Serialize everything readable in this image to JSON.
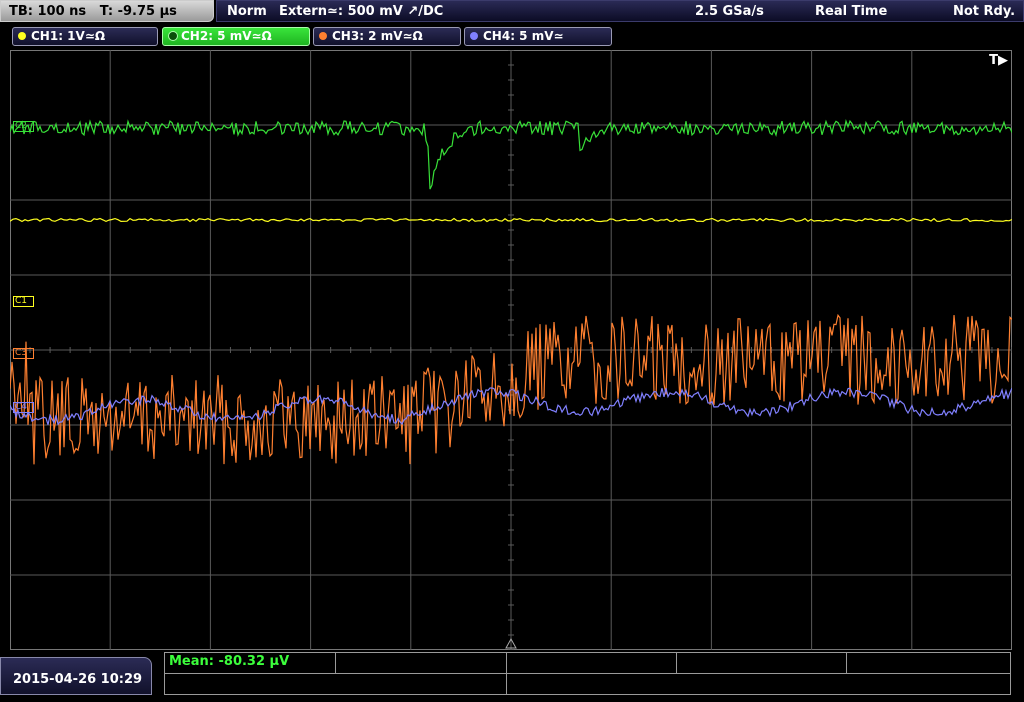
{
  "topbar": {
    "timebase": "TB: 100 ns",
    "trigger_time": "T: -9.75 µs",
    "mode": "Norm",
    "trigger_source": "Extern≃: 500 mV ↗/DC",
    "sample_rate": "2.5 GSa/s",
    "acq_mode": "Real Time",
    "status": "Not Rdy."
  },
  "channels": [
    {
      "label": "CH1: 1V≃Ω",
      "color": "#ffff20",
      "active": false
    },
    {
      "label": "CH2: 5 mV≃Ω",
      "color": "#38e038",
      "active": true
    },
    {
      "label": "CH3: 2 mV≃Ω",
      "color": "#ff8030",
      "active": false
    },
    {
      "label": "CH4: 5 mV≃",
      "color": "#8080ff",
      "active": false
    }
  ],
  "markers": {
    "trigger": "T▶",
    "c1": "C1",
    "c3": "C3",
    "c4": "C4",
    "c2": "C2"
  },
  "datetime": "2015-04-26 10:29",
  "measurement": {
    "mean": "Mean: -80.32 µV"
  },
  "colors": {
    "grid": "#5a5a5a",
    "ch1": "#ffff20",
    "ch2": "#38e038",
    "ch3": "#ff8030",
    "ch4": "#8080ff"
  }
}
